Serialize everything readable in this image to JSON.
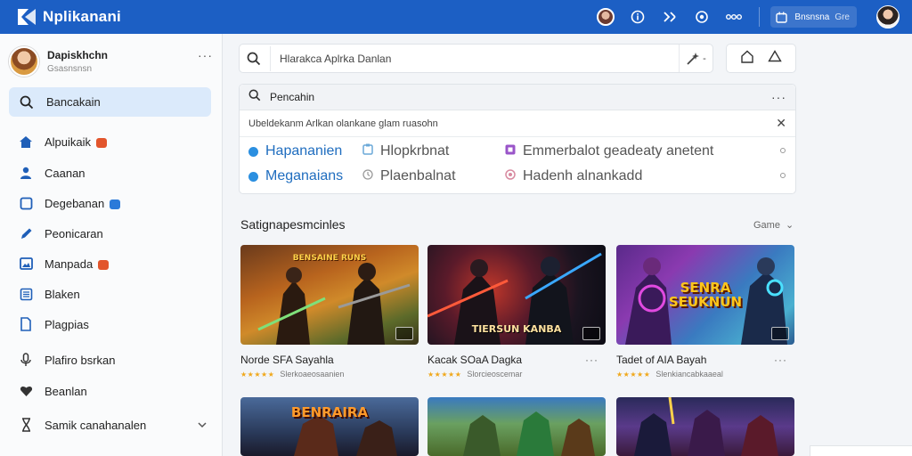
{
  "app": {
    "title": "Nplikanani"
  },
  "topbar": {
    "button_label": "Bnsnsna",
    "button_extra": "Gre"
  },
  "profile": {
    "name": "Dapiskhchn",
    "subtitle": "Gsasnsnsn"
  },
  "sidebar": {
    "active_item": {
      "label": "Bancakain"
    },
    "items": [
      {
        "label": "Alpuikaik",
        "icon": "home-icon",
        "badge": "red"
      },
      {
        "label": "Caanan",
        "icon": "person-icon",
        "badge": ""
      },
      {
        "label": "Degebanan",
        "icon": "square-icon",
        "badge": "blue"
      },
      {
        "label": "Peonicaran",
        "icon": "pen-icon",
        "badge": ""
      },
      {
        "label": "Manpada",
        "icon": "image-icon",
        "badge": "red"
      },
      {
        "label": "Blaken",
        "icon": "list-icon",
        "badge": ""
      },
      {
        "label": "Plagpias",
        "icon": "document-icon",
        "badge": ""
      },
      {
        "label": "Plafiro bsrkan",
        "icon": "mic-icon",
        "badge": ""
      },
      {
        "label": "Beanlan",
        "icon": "heart-icon",
        "badge": ""
      },
      {
        "label": "Samik canahanalen",
        "icon": "hourglass-icon",
        "badge": ""
      }
    ]
  },
  "search": {
    "value": "Hlarakca Aplrka Danlan"
  },
  "panel": {
    "title": "Pencahin",
    "hint": "Ubeldekanm Arlkan olankane glam ruasohn",
    "suggestions": [
      {
        "label": "Hapananien",
        "color": "#2b8fe0"
      },
      {
        "label": "Hlopkrbnat",
        "color": "#6aa8d8"
      },
      {
        "label": "Emmerbalot geadeaty anetent",
        "color": "#9a55c9"
      },
      {
        "label": "Meganaians",
        "color": "#2b8fe0"
      },
      {
        "label": "Plaenbalnat",
        "color": "#999999"
      },
      {
        "label": "Hadenh alnankadd",
        "color": "#d88aa0"
      }
    ]
  },
  "section": {
    "title": "Satignapesmcinles",
    "filter": "Game"
  },
  "cards": [
    {
      "title": "Norde SFA Sayahla",
      "subtitle": "Slerkoaeosaanien",
      "art_text": "BENSAINE RUNS"
    },
    {
      "title": "Kacak SOaA Dagka",
      "subtitle": "Slorcieoscemar",
      "art_text": "TIERSUN KANBA"
    },
    {
      "title": "Tadet of AIA Bayah",
      "subtitle": "Slenkiancabkaaeal",
      "art_text": "SENRA SEUKNUN"
    }
  ],
  "cards_row2": [
    {
      "art_text": "BENRAIRA"
    },
    {
      "art_text": ""
    },
    {
      "art_text": ""
    }
  ],
  "colors": {
    "topbar": "#1c5fc4",
    "active_nav": "#dbeafb",
    "star": "#f0a81c"
  }
}
